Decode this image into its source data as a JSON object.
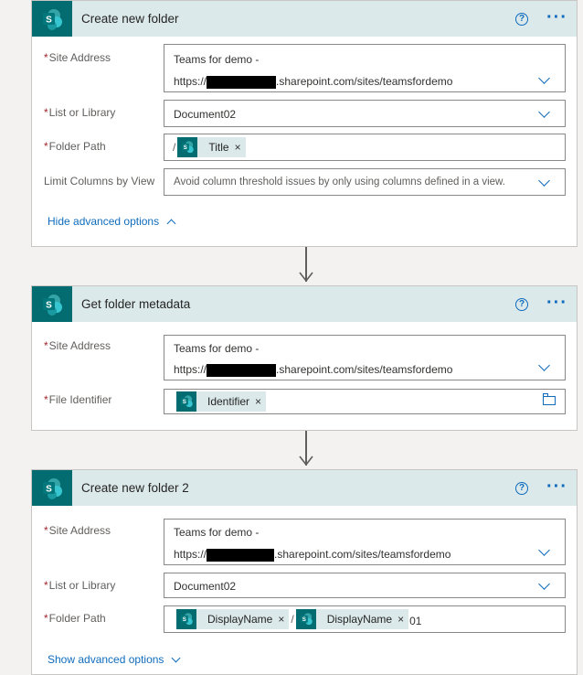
{
  "cards": [
    {
      "title": "Create new folder",
      "site_label": "Site Address",
      "site_line1": "Teams for demo -",
      "site_prefix": "https://",
      "site_suffix": ".sharepoint.com/sites/teamsfordemo",
      "list_label": "List or Library",
      "list_value": "Document02",
      "path_label": "Folder Path",
      "path_slash": "/",
      "path_token": "Title",
      "limit_label": "Limit Columns by View",
      "limit_placeholder": "Avoid column threshold issues by only using columns defined in a view.",
      "advanced": "Hide advanced options"
    },
    {
      "title": "Get folder metadata",
      "site_label": "Site Address",
      "site_line1": "Teams for demo -",
      "site_prefix": "https://",
      "site_suffix": ".sharepoint.com/sites/teamsfordemo",
      "file_label": "File Identifier",
      "file_token": "Identifier"
    },
    {
      "title": "Create new folder 2",
      "site_label": "Site Address",
      "site_line1": "Teams for demo -",
      "site_prefix": "https://",
      "site_suffix": ".sharepoint.com/sites/teamsfordemo",
      "list_label": "List or Library",
      "list_value": "Document02",
      "path_label": "Folder Path",
      "path_token1": "DisplayName",
      "path_slash": "/",
      "path_token2": "DisplayName",
      "path_tail": "01",
      "advanced": "Show advanced options"
    }
  ],
  "icons": {
    "help": "?",
    "more": "···",
    "remove": "×",
    "sharepoint_letter": "S"
  },
  "colors": {
    "sharepoint_teal": "#036c70",
    "header_bg": "#dbe9ea",
    "link_blue": "#0f6cbd",
    "required_red": "#a4262c"
  }
}
